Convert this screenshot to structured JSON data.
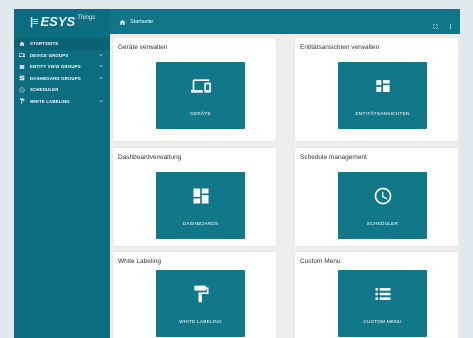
{
  "logo": {
    "mark": "|≡",
    "text": "ESYS",
    "sub": "Things"
  },
  "topbar": {
    "breadcrumb": "Startseite",
    "icons": [
      "fullscreen-icon",
      "more-vert-icon"
    ]
  },
  "sidebar": {
    "items": [
      {
        "label": "STARTSEITE",
        "icon": "home-icon",
        "active": true,
        "expandable": false
      },
      {
        "label": "DEVICE GROUPS",
        "icon": "devices-icon",
        "expandable": true
      },
      {
        "label": "ENTITY VIEW GROUPS",
        "icon": "view-list-icon",
        "expandable": true
      },
      {
        "label": "DASHBOARD GROUPS",
        "icon": "dashboard-icon",
        "expandable": true
      },
      {
        "label": "SCHEDULER",
        "icon": "clock-icon",
        "expandable": false
      },
      {
        "label": "WHITE LABELING",
        "icon": "paint-roller-icon",
        "expandable": true
      }
    ]
  },
  "cards": [
    {
      "title": "Geräte verwalten",
      "tile_label": "GERÄTE",
      "icon": "devices-icon"
    },
    {
      "title": "Entitätsansichten verwalten",
      "tile_label": "ENTITÄTSANSICHTEN",
      "icon": "entity-view-icon"
    },
    {
      "title": "Dashboardverwaltung",
      "tile_label": "DASHBOARDS",
      "icon": "dashboard-icon"
    },
    {
      "title": "Schedule management",
      "tile_label": "SCHEDULER",
      "icon": "clock-icon"
    },
    {
      "title": "White Labeling",
      "tile_label": "WHITE LABELING",
      "icon": "paint-roller-icon"
    },
    {
      "title": "Custom Menu",
      "tile_label": "CUSTOM MENU",
      "icon": "menu-list-icon"
    }
  ],
  "colors": {
    "sidebar": "#0d6d80",
    "topbar": "#0f7587",
    "tile": "#11788a",
    "background": "#eeeeee"
  }
}
